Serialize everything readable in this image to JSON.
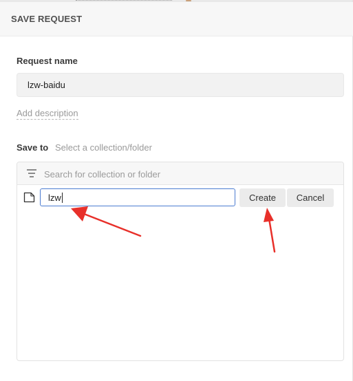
{
  "dialog": {
    "title": "SAVE REQUEST"
  },
  "request_name": {
    "label": "Request name",
    "value": "lzw-baidu"
  },
  "add_description": {
    "label": "Add description"
  },
  "save_to": {
    "label": "Save to",
    "hint": "Select a collection/folder"
  },
  "collection_search": {
    "placeholder": "Search for collection or folder",
    "icon": "filter-icon"
  },
  "new_collection": {
    "icon": "folder-icon",
    "value": "lzw",
    "create_label": "Create",
    "cancel_label": "Cancel"
  },
  "annotations": {
    "arrow_color": "#e8302a"
  },
  "colors": {
    "focus_border": "#4a7bd0",
    "header_bg": "#f7f7f7",
    "input_bg": "#f2f2f2",
    "button_bg": "#ebebeb"
  }
}
